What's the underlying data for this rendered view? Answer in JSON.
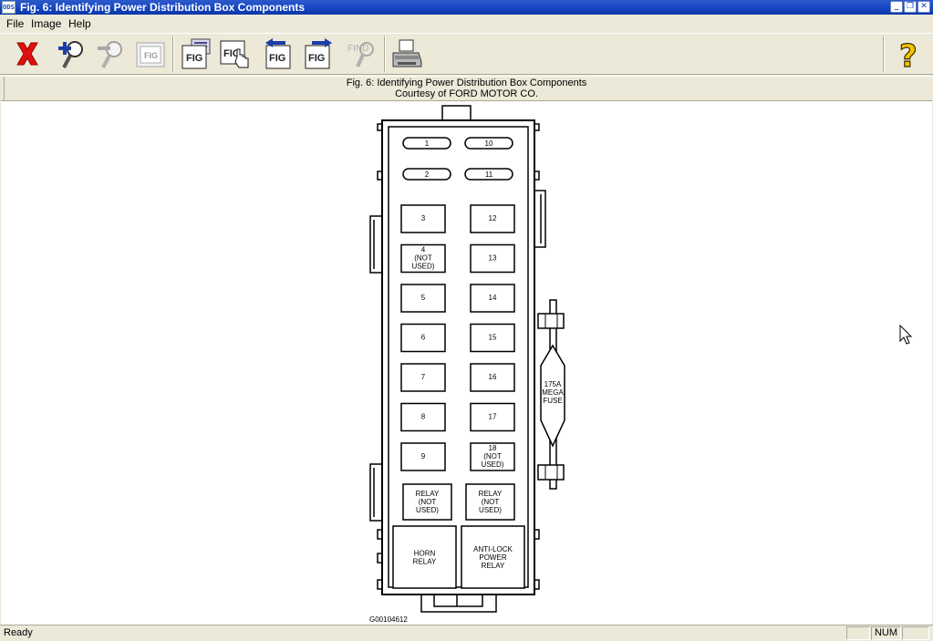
{
  "window": {
    "app_icon_text": "ODS",
    "title": "Fig. 6: Identifying Power Distribution Box Components",
    "min_label": "_",
    "max_label": "❐",
    "close_label": "✕"
  },
  "menu": {
    "file": "File",
    "image": "Image",
    "help": "Help"
  },
  "toolbar": {
    "buttons": [
      {
        "name": "close-image-button",
        "icon": "red-x-icon"
      },
      {
        "name": "zoom-in-button",
        "icon": "zoom-in-icon"
      },
      {
        "name": "zoom-out-button",
        "icon": "zoom-out-icon",
        "disabled": true
      },
      {
        "name": "fit-figure-button",
        "icon": "fig-fit-icon",
        "disabled": true
      },
      {
        "name": "figure-list-button",
        "icon": "fig-list-icon"
      },
      {
        "name": "figure-select-button",
        "icon": "fig-hand-icon"
      },
      {
        "name": "previous-figure-button",
        "icon": "fig-prev-icon"
      },
      {
        "name": "next-figure-button",
        "icon": "fig-next-icon"
      },
      {
        "name": "find-button",
        "icon": "find-icon",
        "disabled": true
      },
      {
        "name": "print-button",
        "icon": "printer-icon"
      },
      {
        "name": "help-button",
        "icon": "question-icon"
      }
    ],
    "find_label": "FIND"
  },
  "caption": {
    "title": "Fig. 6: Identifying Power Distribution Box Components",
    "courtesy": "Courtesy of FORD MOTOR CO."
  },
  "diagram": {
    "fuses_top": [
      {
        "left": "1",
        "right": "10"
      },
      {
        "left": "2",
        "right": "11"
      }
    ],
    "fuse_rows": [
      {
        "left": [
          "3"
        ],
        "right": [
          "12"
        ]
      },
      {
        "left": [
          "4",
          "(NOT",
          "USED)"
        ],
        "right": [
          "13"
        ]
      },
      {
        "left": [
          "5"
        ],
        "right": [
          "14"
        ]
      },
      {
        "left": [
          "6"
        ],
        "right": [
          "15"
        ]
      },
      {
        "left": [
          "7"
        ],
        "right": [
          "16"
        ]
      },
      {
        "left": [
          "8"
        ],
        "right": [
          "17"
        ]
      },
      {
        "left": [
          "9"
        ],
        "right": [
          "18",
          "(NOT",
          "USED)"
        ]
      }
    ],
    "relays_small": [
      [
        "RELAY",
        "(NOT",
        "USED)"
      ],
      [
        "RELAY",
        "(NOT",
        "USED)"
      ]
    ],
    "relays_large": [
      [
        "HORN",
        "RELAY"
      ],
      [
        "ANTI-LOCK",
        "POWER",
        "RELAY"
      ]
    ],
    "mega_fuse": [
      "175A",
      "MEGA",
      "FUSE"
    ],
    "figure_id": "G00104612"
  },
  "status": {
    "text": "Ready",
    "num": "NUM"
  }
}
